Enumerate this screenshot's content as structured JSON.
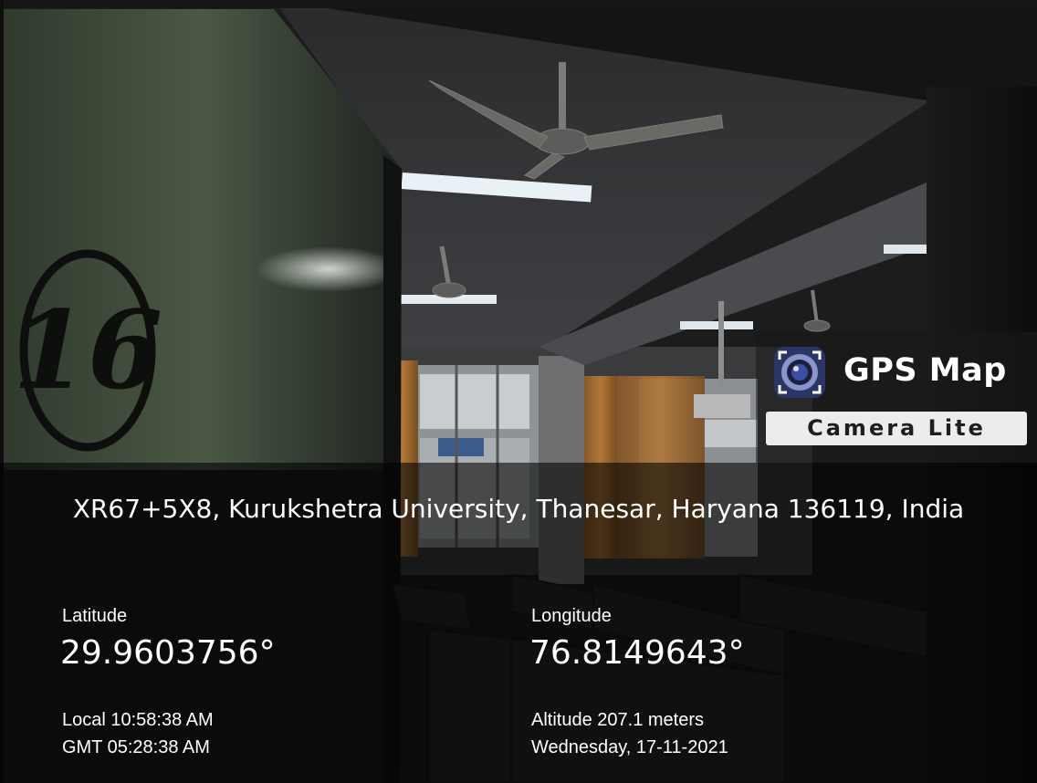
{
  "watermark": {
    "title": "GPS Map",
    "subtitle": "Camera Lite",
    "icon": "camera-lens-icon"
  },
  "photo": {
    "room_number": "16"
  },
  "location": {
    "address": "XR67+5X8, Kurukshetra University, Thanesar, Haryana 136119, India",
    "latitude_label": "Latitude",
    "latitude_value": "29.9603756°",
    "longitude_label": "Longitude",
    "longitude_value": "76.8149643°",
    "local_time": "Local 10:58:38 AM",
    "gmt_time": "GMT 05:28:38 AM",
    "altitude": "Altitude 207.1 meters",
    "date": "Wednesday, 17-11-2021"
  },
  "colors": {
    "panel_bg": "#000000",
    "text": "#ffffff",
    "badge_bg": "#ececec"
  }
}
